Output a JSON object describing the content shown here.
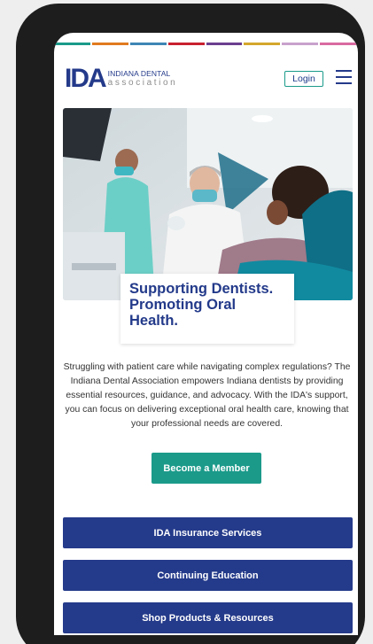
{
  "colors": {
    "brand_blue": "#243a8a",
    "teal": "#1b9a8a",
    "stripe": [
      "#1a9a8a",
      "#e07a1f",
      "#3e86b5",
      "#c8202f",
      "#6b3f8f",
      "#d4a72c",
      "#c8a2cc",
      "#d96aa0"
    ]
  },
  "logo": {
    "mark": "IDA",
    "line1": "INDIANA DENTAL",
    "line2": "association"
  },
  "header": {
    "login_label": "Login",
    "menu_icon": "hamburger-menu-icon"
  },
  "hero": {
    "heading": "Supporting Dentists. Promoting Oral Health."
  },
  "intro": {
    "text": "Struggling with patient care while navigating complex regulations? The Indiana Dental Association empowers Indiana dentists by providing essential resources, guidance, and advocacy. With the IDA's support, you can focus on delivering exceptional oral health care, knowing that your professional needs are covered."
  },
  "cta": {
    "member_label": "Become a Member"
  },
  "nav_buttons": [
    {
      "label": "IDA Insurance Services"
    },
    {
      "label": "Continuing Education"
    },
    {
      "label": "Shop Products & Resources"
    }
  ]
}
